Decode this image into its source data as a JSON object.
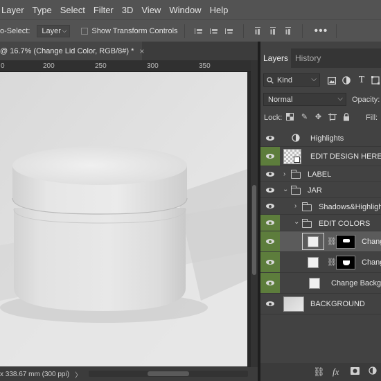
{
  "menu": [
    "Layer",
    "Type",
    "Select",
    "Filter",
    "3D",
    "View",
    "Window",
    "Help"
  ],
  "options_bar": {
    "auto_select_label": "o-Select:",
    "auto_select_value": "Layer",
    "show_transform_label": "Show Transform Controls",
    "more_label": "•••"
  },
  "document": {
    "tab_title": "@ 16.7% (Change Lid Color, RGB/8#) *",
    "close_label": "×",
    "ruler_labels": [
      "0",
      "200",
      "250",
      "300",
      "350"
    ],
    "status_text": "x 338.67 mm (300 ppi)",
    "status_arrow": "〉"
  },
  "panel": {
    "tabs": [
      "Layers",
      "History"
    ],
    "filter_kind": "Kind",
    "blend_mode": "Normal",
    "opacity_label": "Opacity:",
    "lock_label": "Lock:",
    "fill_label": "Fill:"
  },
  "layers": [
    {
      "name": "Highlights",
      "visible": true
    },
    {
      "name": "EDIT DESIGN HERE",
      "visible": true
    },
    {
      "name": "LABEL",
      "visible": true
    },
    {
      "name": "JAR",
      "visible": true
    },
    {
      "name": "Shadows&Highlights",
      "visible": true
    },
    {
      "name": "EDIT COLORS",
      "visible": true
    },
    {
      "name": "Chang",
      "visible": true
    },
    {
      "name": "Chang",
      "visible": true
    },
    {
      "name": "Change Backgrou",
      "visible": true
    },
    {
      "name": "BACKGROUND",
      "visible": true
    }
  ],
  "colors": {
    "visibility_highlight": "#5d7d3c",
    "selected_row": "#5b5b5b",
    "panel_bg": "#424242",
    "toolbar_bg": "#535353"
  }
}
